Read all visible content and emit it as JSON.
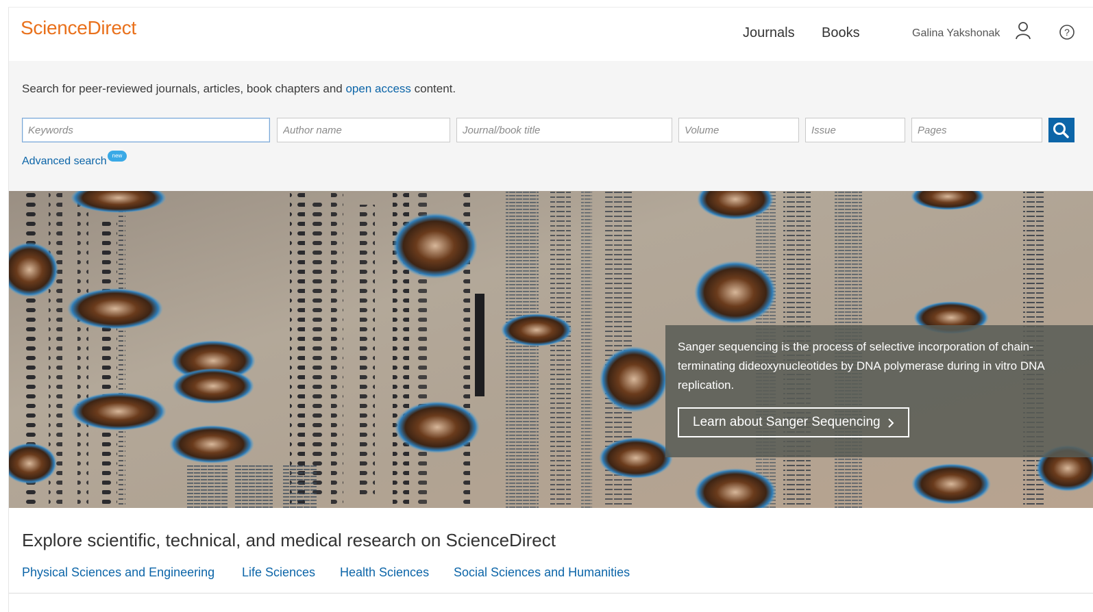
{
  "header": {
    "logo": "ScienceDirect",
    "nav": {
      "journals": "Journals",
      "books": "Books"
    },
    "user_name": "Galina Yakshonak",
    "icons": {
      "user": "user-icon",
      "help": "help-icon"
    }
  },
  "search": {
    "intro_before": "Search for peer-reviewed journals, articles, book chapters and ",
    "intro_link": "open access",
    "intro_after": " content.",
    "fields": {
      "keywords": "Keywords",
      "author": "Author name",
      "journal": "Journal/book title",
      "volume": "Volume",
      "issue": "Issue",
      "pages": "Pages"
    },
    "advanced_label": "Advanced search",
    "badge": "new",
    "button_icon": "search-icon"
  },
  "hero": {
    "caption": "Sanger sequencing is the process of selective incorporation of chain-terminating dideoxynucleotides by DNA polymerase during in vitro DNA replication.",
    "cta_label": "Learn about Sanger Sequencing"
  },
  "explore": {
    "title": "Explore scientific, technical, and medical research on ScienceDirect",
    "categories": [
      "Physical Sciences and Engineering",
      "Life Sciences",
      "Health Sciences",
      "Social Sciences and Humanities"
    ]
  },
  "colors": {
    "brand_orange": "#e9711c",
    "link_blue": "#0c65a8",
    "search_button": "#0c65a8",
    "badge": "#3aa9e6"
  }
}
